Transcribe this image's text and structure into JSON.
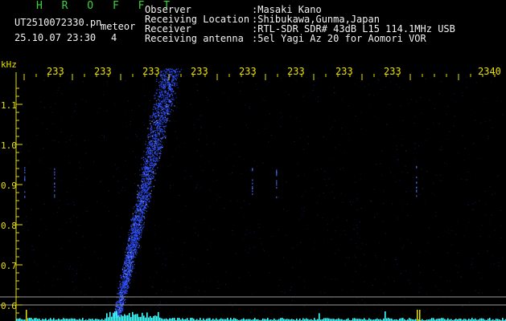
{
  "header": {
    "app_title": "H R O F F T",
    "file_name": "UT2510072330.pn",
    "meteor_label": "meteor",
    "date_time": "25.10.07 23:30",
    "count": "4"
  },
  "station_info": {
    "observer_label": "Observer",
    "observer_value": ":Masaki Kano",
    "location_label": "Receiving Location",
    "location_value": ":Shibukawa,Gunma,Japan",
    "receiver_label": "Receiver",
    "receiver_value": ":RTL-SDR SDR# 43dB L15 114.1MHz USB",
    "antenna_label": "Receiving antenna",
    "antenna_value": ":5el Yagi Az 20 for Aomori VOR"
  },
  "axes": {
    "y_unit": "kHz",
    "x_ticks": [
      "233",
      "233",
      "233",
      "233",
      "233",
      "233",
      "233",
      "233",
      "2340"
    ],
    "y_ticks": [
      "1.1",
      "1.0",
      "0.9",
      "0.8",
      "0.7",
      "0.6"
    ]
  },
  "colors": {
    "background": "#000000",
    "title": "#3ad23a",
    "axis_text": "#e8e000",
    "info_text": "#f2f2f2",
    "signal": "#3050ff",
    "noise_floor": "#40ffff"
  }
}
